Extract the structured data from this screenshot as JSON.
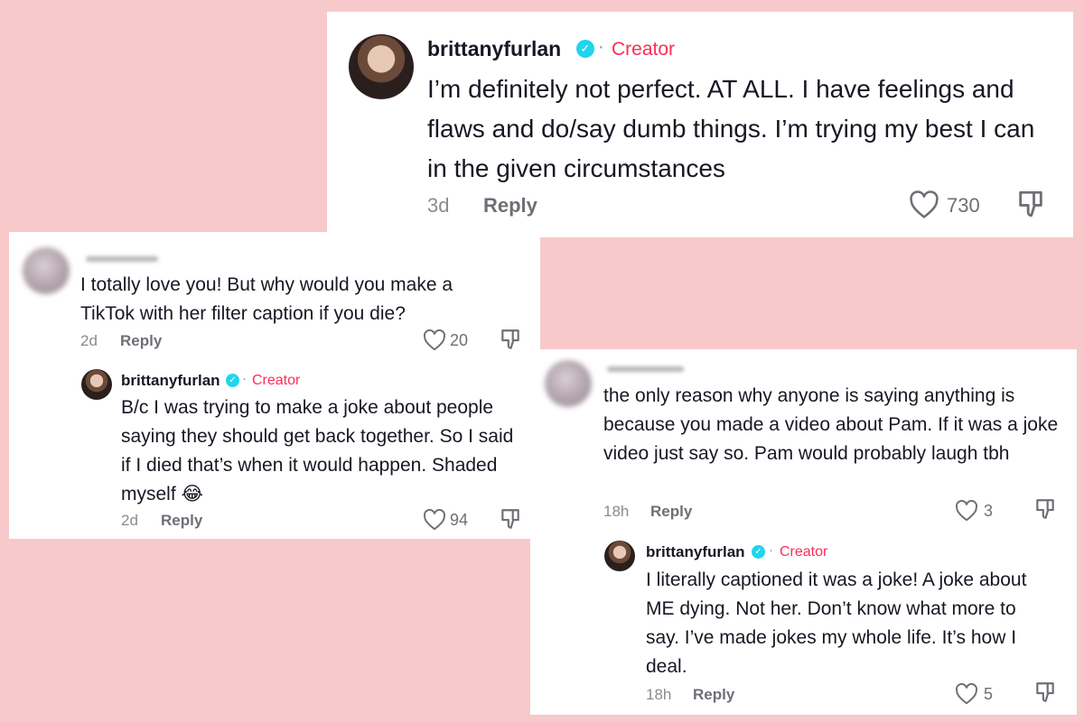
{
  "top_comment": {
    "username": "brittanyfurlan",
    "creator_label": "Creator",
    "separator": "·",
    "text": "I’m definitely not perfect. AT ALL. I have feelings and flaws and do/say dumb things. I’m trying my best I can in the given circumstances",
    "age": "3d",
    "reply_label": "Reply",
    "likes": "730"
  },
  "left_thread": {
    "comment": {
      "text": "I totally love you! But why would you make a TikTok with her filter caption if you die?",
      "age": "2d",
      "reply_label": "Reply",
      "likes": "20"
    },
    "reply": {
      "username": "brittanyfurlan",
      "creator_label": "Creator",
      "separator": "·",
      "text": "B/c I was trying to make a joke about people saying they should get back together. So I said if I died that’s when it would happen. Shaded myself 😂",
      "age": "2d",
      "reply_label": "Reply",
      "likes": "94"
    }
  },
  "right_thread": {
    "comment": {
      "text": "the only reason why anyone is saying anything is because you made a video about Pam. If it was a joke video just say so. Pam would probably laugh tbh",
      "age": "18h",
      "reply_label": "Reply",
      "likes": "3"
    },
    "reply": {
      "username": "brittanyfurlan",
      "creator_label": "Creator",
      "separator": "·",
      "text": "I literally captioned it was a joke! A joke about ME dying. Not her. Don’t know what more to say. I’ve made jokes my whole life. It’s how I deal.",
      "age": "18h",
      "reply_label": "Reply",
      "likes": "5"
    }
  },
  "icons": {
    "verified": "verified-badge-icon",
    "like": "heart-outline-icon",
    "dislike": "thumbs-down-outline-icon"
  },
  "colors": {
    "background": "#f7c9cb",
    "creator": "#fe2c55",
    "verified": "#20d5ec",
    "meta": "#8a8b91"
  }
}
